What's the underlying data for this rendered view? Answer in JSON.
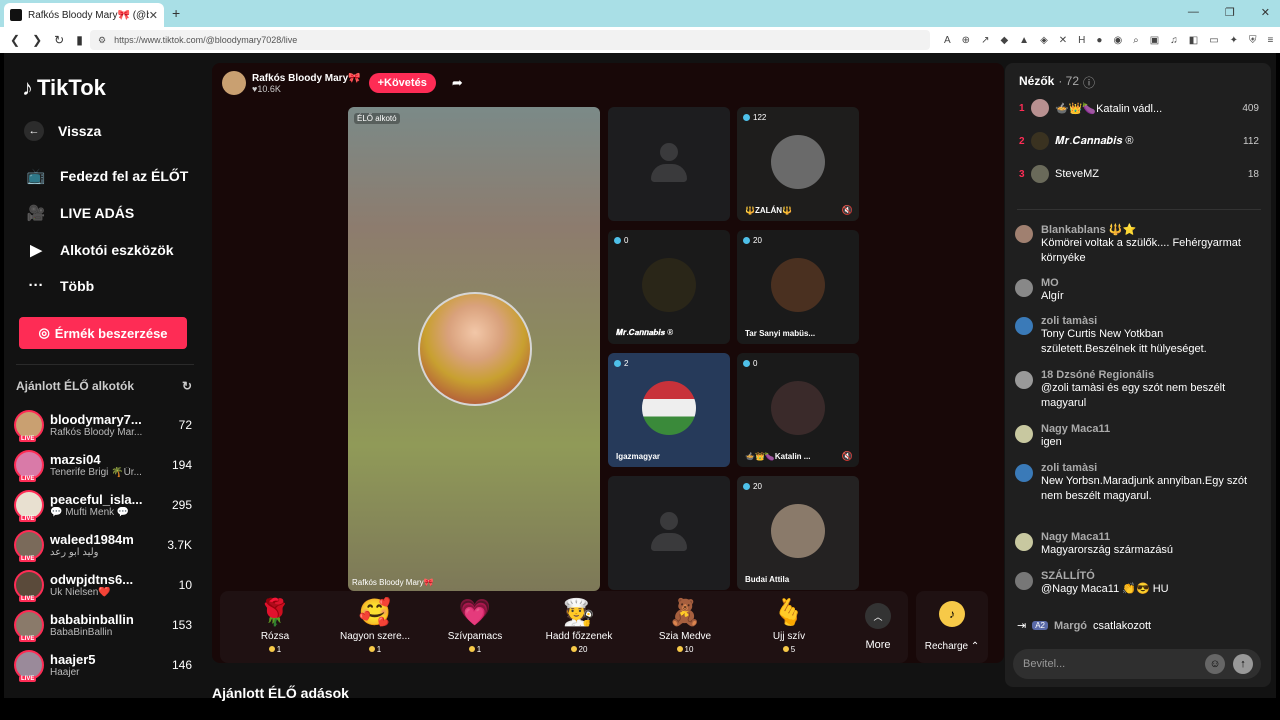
{
  "browser": {
    "tab_title": "Rafkós Bloody Mary🎀 (@blo",
    "tab_close": "✕",
    "new_tab": "+",
    "url": "https://www.tiktok.com/@bloodymary7028/live"
  },
  "sidebar": {
    "logo": "TikTok",
    "back": "Vissza",
    "nav": [
      "Fedezd fel az ÉLŐT",
      "LIVE ADÁS",
      "Alkotói eszközök",
      "Több"
    ],
    "coin_button": "Érmék beszerzése",
    "recommended_title": "Ajánlott ÉLŐ alkotók",
    "live_badge": "LIVE",
    "creators": [
      {
        "name": "bloodymary7...",
        "sub": "Rafkós Bloody Mar...",
        "count": "72"
      },
      {
        "name": "mazsi04",
        "sub": "Tenerife Brigi 🌴Ür...",
        "count": "194"
      },
      {
        "name": "peaceful_isla...",
        "sub": "💬 Mufti Menk 💬",
        "count": "295"
      },
      {
        "name": "waleed1984m",
        "sub": "وليد ابو رعد",
        "count": "3.7K"
      },
      {
        "name": "odwpjdtns6...",
        "sub": "Uk Nielsen❤️",
        "count": "10"
      },
      {
        "name": "bababinballin",
        "sub": "BabaBinBallin",
        "count": "153"
      },
      {
        "name": "haajer5",
        "sub": "Haajer",
        "count": "146"
      }
    ]
  },
  "host": {
    "name": "Rafkós Bloody Mary🎀",
    "likes": "♥10.6K",
    "follow": "+Követés"
  },
  "stream": {
    "main_label": "ÉLŐ alkotó",
    "main_name": "Rafkós Bloody Mary🎀",
    "tiles": [
      {
        "count": "",
        "name": "",
        "blank": true
      },
      {
        "count": "122",
        "name": "🔱ZALÁN🔱"
      },
      {
        "count": "0",
        "name": "𝑴𝒓.𝑪𝒂𝒏𝒏𝒂𝒃𝒊𝒔 ®"
      },
      {
        "count": "20",
        "name": "Tar Sanyi mabüs..."
      },
      {
        "count": "2",
        "name": "Igazmagyar"
      },
      {
        "count": "0",
        "name": "🍲👑🍆Katalin ..."
      },
      {
        "count": "",
        "name": "",
        "blank": true
      },
      {
        "count": "20",
        "name": "Budai Attila"
      }
    ]
  },
  "gifts": [
    {
      "name": "Rózsa",
      "price": "1",
      "icon": "🌹"
    },
    {
      "name": "Nagyon szere...",
      "price": "1",
      "icon": "🥰"
    },
    {
      "name": "Szívpamacs",
      "price": "1",
      "icon": "💗"
    },
    {
      "name": "Hadd főzzenek",
      "price": "20",
      "icon": "🧑‍🍳"
    },
    {
      "name": "Szia Medve",
      "price": "10",
      "icon": "🧸"
    },
    {
      "name": "Ujj szív",
      "price": "5",
      "icon": "🫰"
    }
  ],
  "more_label": "More",
  "recharge_label": "Recharge ⌃",
  "bottom_title": "Ajánlott ÉLŐ adások",
  "viewers": {
    "title": "Nézők",
    "count": "· 72",
    "top": [
      {
        "rank": "1",
        "name": "🍲👑🍆Katalin vádl...",
        "score": "409"
      },
      {
        "rank": "2",
        "name": "𝑴𝒓.𝑪𝒂𝒏𝒏𝒂𝒃𝒊𝒔 ®",
        "score": "112"
      },
      {
        "rank": "3",
        "name": "SteveMZ",
        "score": "18"
      }
    ]
  },
  "chat": [
    {
      "user": "Blankablans 🔱⭐",
      "msg": "Kömörei voltak a szülők.... Fehérgyarmat környéke"
    },
    {
      "user": "MO",
      "msg": "Algír"
    },
    {
      "user": "zoli tamàsi",
      "msg": "Tony Curtis New Yotkban született.Beszélnek itt hülyeséget."
    },
    {
      "user": "18 Dzsóné Regionális",
      "msg": "@zoli tamàsi és egy szót nem beszélt magyarul"
    },
    {
      "user": "Nagy Maca11",
      "msg": "igen"
    },
    {
      "user": "zoli tamàsi",
      "msg": "New Yorbsn.Maradjunk annyiban.Egy szót nem beszélt magyarul."
    },
    {
      "user": "Nagy Maca11",
      "msg": "Magyarország származású"
    },
    {
      "user": "SZÁLLÍTÓ",
      "msg": "@Nagy Maca11 👏😎 HU"
    }
  ],
  "joined": {
    "level": "A2",
    "user": "Margó",
    "text": "csatlakozott"
  },
  "input_placeholder": "Bevitel..."
}
